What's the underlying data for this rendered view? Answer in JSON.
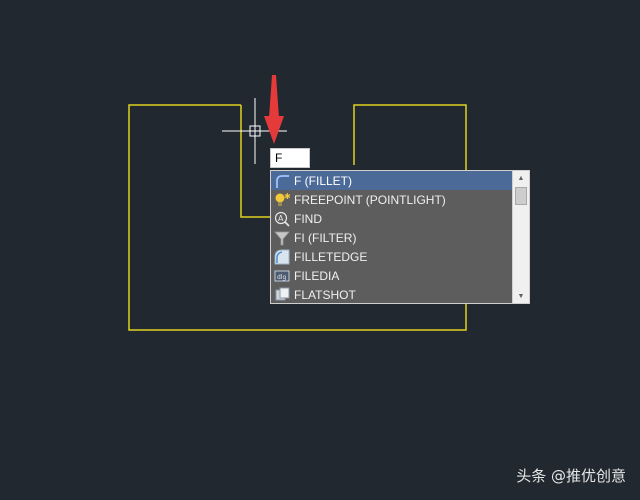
{
  "command_input": {
    "value": "F"
  },
  "autocomplete": {
    "items": [
      {
        "label": "F (FILLET)",
        "icon": "fillet-icon",
        "selected": true
      },
      {
        "label": "FREEPOINT (POINTLIGHT)",
        "icon": "pointlight-icon",
        "selected": false
      },
      {
        "label": "FIND",
        "icon": "find-icon",
        "selected": false
      },
      {
        "label": "FI (FILTER)",
        "icon": "filter-icon",
        "selected": false
      },
      {
        "label": "FILLETEDGE",
        "icon": "filletedge-icon",
        "selected": false
      },
      {
        "label": "FILEDIA",
        "icon": "filedia-icon",
        "selected": false
      },
      {
        "label": "FLATSHOT",
        "icon": "flatshot-icon",
        "selected": false
      }
    ]
  },
  "watermark": {
    "text": "头条 @推优创意"
  },
  "colors": {
    "background": "#212830",
    "drawing_lines": "#e0d21e",
    "arrow": "#e53a3a",
    "selected_item": "#4b6a98",
    "list_background": "#5d5d5d"
  }
}
